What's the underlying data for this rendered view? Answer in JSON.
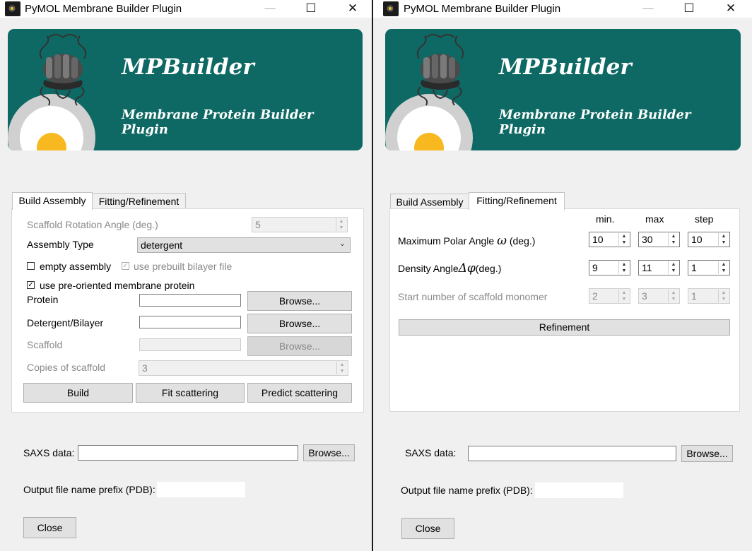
{
  "window_title": "PyMOL Membrane Builder Plugin",
  "titlebar_buttons": {
    "minimize": "—",
    "maximize": "☐",
    "close": "✕"
  },
  "banner": {
    "title": "MPBuilder",
    "subtitle": "Membrane Protein Builder Plugin"
  },
  "tabs": [
    "Build Assembly",
    "Fitting/Refinement"
  ],
  "build_assembly": {
    "rotation_label": "Scaffold Rotation Angle (deg.)",
    "rotation_value": "5",
    "assembly_type_label": "Assembly Type",
    "assembly_type_value": "detergent",
    "empty_assembly_label": "empty assembly",
    "empty_assembly_checked": false,
    "prebuilt_label": "use prebuilt bilayer file",
    "prebuilt_checked": true,
    "preoriented_label": "use pre-oriented membrane protein",
    "preoriented_checked": true,
    "protein_label": "Protein",
    "detergent_label": "Detergent/Bilayer",
    "scaffold_label": "Scaffold",
    "browse_label": "Browse...",
    "copies_label": "Copies of scaffold",
    "copies_value": "3",
    "build_button": "Build",
    "fit_button": "Fit scattering",
    "predict_button": "Predict scattering"
  },
  "fitting": {
    "col_min": "min.",
    "col_max": "max",
    "col_step": "step",
    "polar_label": "Maximum Polar Angle",
    "polar_symbol": "ω",
    "polar_unit": "(deg.)",
    "polar_values": [
      "10",
      "30",
      "10"
    ],
    "density_label": "Density Angle",
    "density_symbol": "Δφ",
    "density_unit": "(deg.)",
    "density_values": [
      "9",
      "11",
      "1"
    ],
    "start_label": "Start number of scaffold monomer",
    "start_values": [
      "2",
      "3",
      "1"
    ],
    "refinement_button": "Refinement"
  },
  "bottom": {
    "saxs_label": "SAXS data:",
    "browse_label": "Browse...",
    "prefix_label": "Output file name prefix (PDB):",
    "close_button": "Close"
  }
}
